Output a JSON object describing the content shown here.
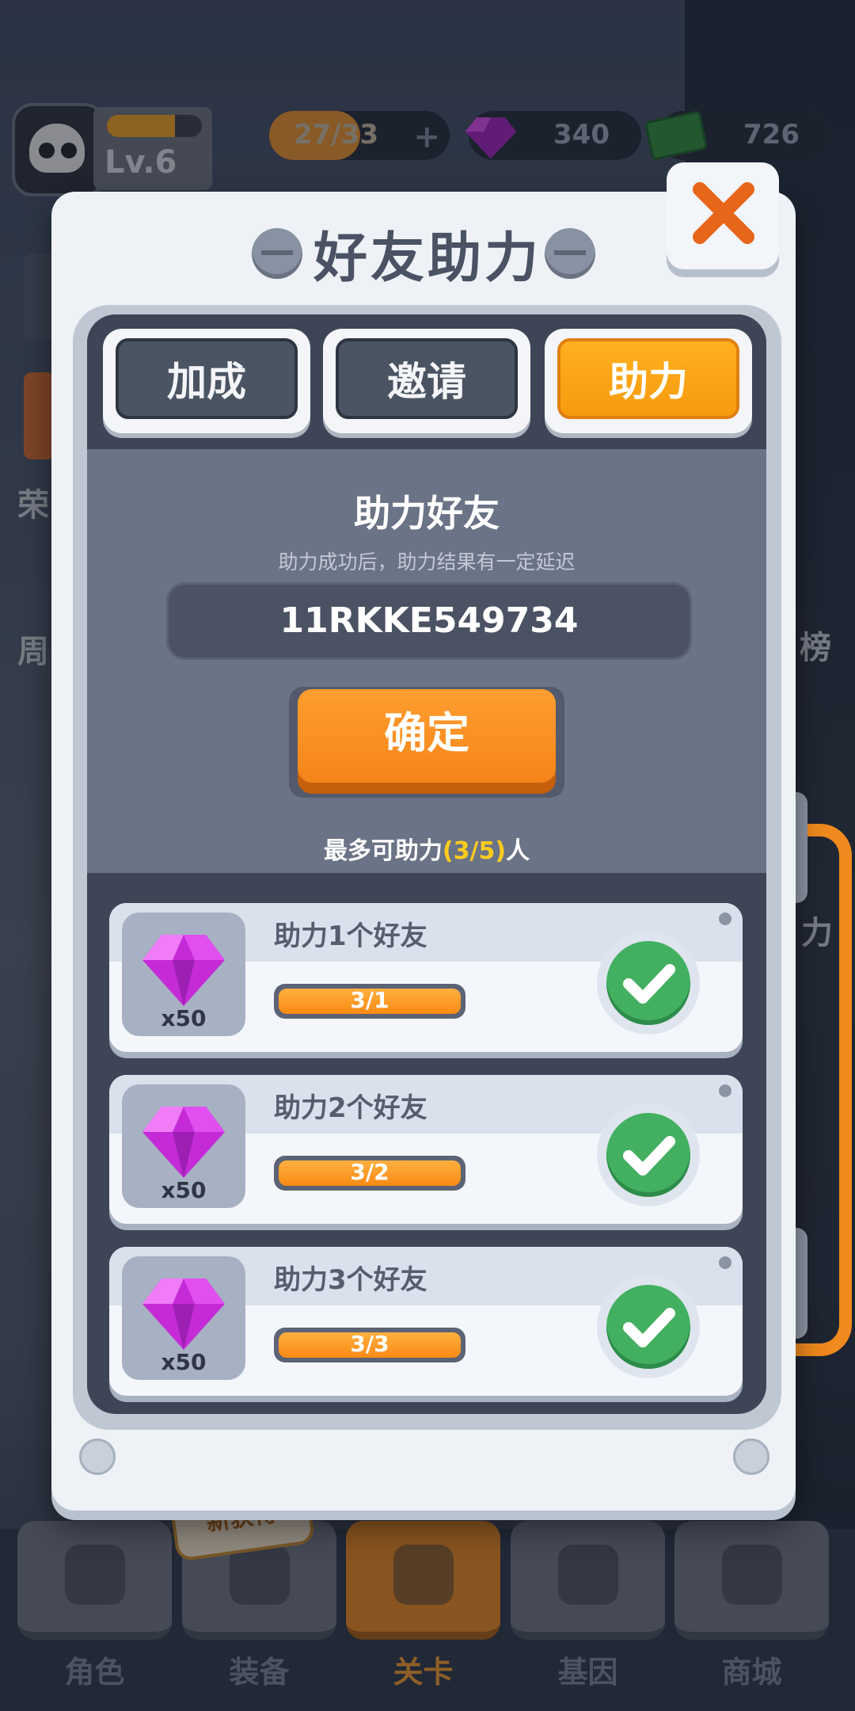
{
  "hud": {
    "level": "Lv.6",
    "level_progress": 0.72,
    "energy": "27/33",
    "gems": "340",
    "cash": "726"
  },
  "side_labels": [
    "荣",
    "周",
    "榜",
    "力"
  ],
  "popup": {
    "title": "好友助力",
    "tabs": [
      {
        "label": "加成",
        "active": false
      },
      {
        "label": "邀请",
        "active": false
      },
      {
        "label": "助力",
        "active": true
      }
    ],
    "form": {
      "heading": "助力好友",
      "hint": "助力成功后，助力结果有一定延迟",
      "code": "11RKKE549734",
      "confirm_label": "确定",
      "limit_prefix": "最多可助力",
      "limit_value": "(3/5)",
      "limit_suffix": "人"
    },
    "tasks": [
      {
        "title": "助力1个好友",
        "reward_qty": "x50",
        "progress": "3/1",
        "done": true
      },
      {
        "title": "助力2个好友",
        "reward_qty": "x50",
        "progress": "3/2",
        "done": true
      },
      {
        "title": "助力3个好友",
        "reward_qty": "x50",
        "progress": "3/3",
        "done": true
      }
    ]
  },
  "bottom_nav": {
    "items": [
      {
        "label": "角色",
        "icon": "skull-icon",
        "active": false
      },
      {
        "label": "装备",
        "icon": "gun-icon",
        "active": false
      },
      {
        "label": "关卡",
        "icon": "map-pin-icon",
        "active": true
      },
      {
        "label": "基因",
        "icon": "hexagons-icon",
        "active": false
      },
      {
        "label": "商城",
        "icon": "shop-icon",
        "active": false
      }
    ],
    "badge": "新获得"
  },
  "colors": {
    "accent_orange": "#f79a0e",
    "check_green": "#43b061",
    "highlight_yellow": "#ffcc1e"
  }
}
